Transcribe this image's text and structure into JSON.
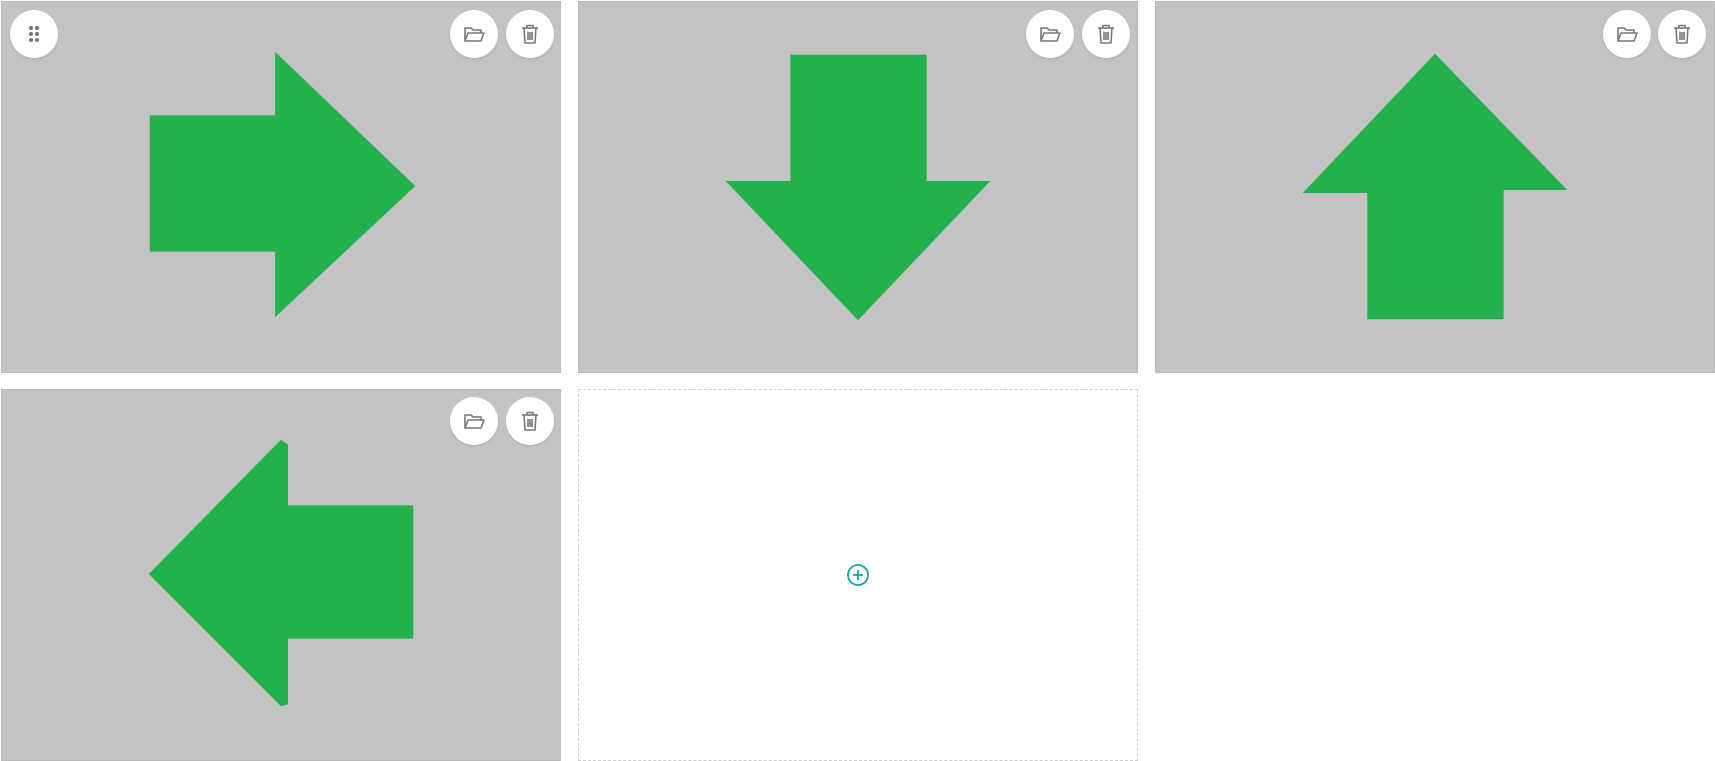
{
  "colors": {
    "tile_background": "#c3c3c3",
    "arrow_fill": "#23b14d",
    "icon_gray": "#777777",
    "add_accent": "#16a79a"
  },
  "tiles": [
    {
      "direction": "right",
      "actions": [
        "drag-handle-icon",
        "folder-open-icon",
        "trash-icon"
      ]
    },
    {
      "direction": "down",
      "actions": [
        "folder-open-icon",
        "trash-icon"
      ]
    },
    {
      "direction": "up",
      "actions": [
        "folder-open-icon",
        "trash-icon"
      ]
    },
    {
      "direction": "left",
      "actions": [
        "folder-open-icon",
        "trash-icon"
      ]
    }
  ],
  "add_tile": {
    "icon": "add-circle-icon"
  }
}
